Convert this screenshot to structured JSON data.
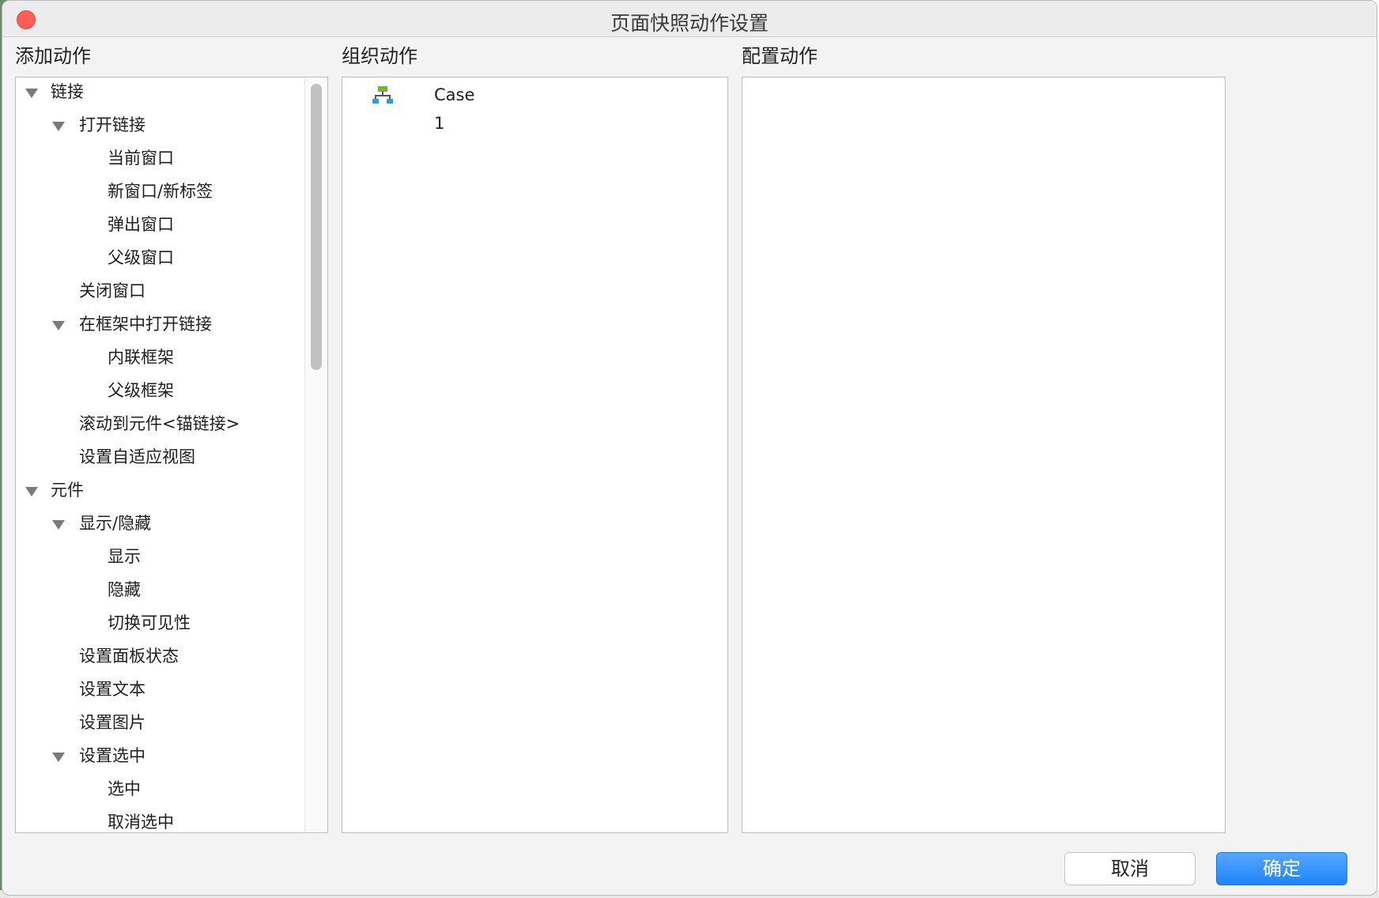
{
  "window": {
    "title": "页面快照动作设置"
  },
  "panels": {
    "add": {
      "label": "添加动作"
    },
    "organize": {
      "label": "组织动作",
      "cases": [
        {
          "label": "Case 1",
          "icon": "case-tree-icon"
        }
      ]
    },
    "configure": {
      "label": "配置动作"
    }
  },
  "tree": [
    {
      "label": "链接",
      "level": 0,
      "expanded": true
    },
    {
      "label": "打开链接",
      "level": 1,
      "expanded": true
    },
    {
      "label": "当前窗口",
      "level": 2
    },
    {
      "label": "新窗口/新标签",
      "level": 2
    },
    {
      "label": "弹出窗口",
      "level": 2
    },
    {
      "label": "父级窗口",
      "level": 2
    },
    {
      "label": "关闭窗口",
      "level": 1
    },
    {
      "label": "在框架中打开链接",
      "level": 1,
      "expanded": true
    },
    {
      "label": "内联框架",
      "level": 2
    },
    {
      "label": "父级框架",
      "level": 2
    },
    {
      "label": "滚动到元件<锚链接>",
      "level": 1
    },
    {
      "label": "设置自适应视图",
      "level": 1
    },
    {
      "label": "元件",
      "level": 0,
      "expanded": true
    },
    {
      "label": "显示/隐藏",
      "level": 1,
      "expanded": true
    },
    {
      "label": "显示",
      "level": 2
    },
    {
      "label": "隐藏",
      "level": 2
    },
    {
      "label": "切换可见性",
      "level": 2
    },
    {
      "label": "设置面板状态",
      "level": 1
    },
    {
      "label": "设置文本",
      "level": 1
    },
    {
      "label": "设置图片",
      "level": 1
    },
    {
      "label": "设置选中",
      "level": 1,
      "expanded": true
    },
    {
      "label": "选中",
      "level": 2
    },
    {
      "label": "取消选中",
      "level": 2
    }
  ],
  "buttons": {
    "cancel": "取消",
    "ok": "确定"
  },
  "colors": {
    "primary": "#1e85fb",
    "close": "#fc5f57",
    "case_icon_green": "#6aba2e",
    "case_icon_blue": "#2a9fd8"
  }
}
